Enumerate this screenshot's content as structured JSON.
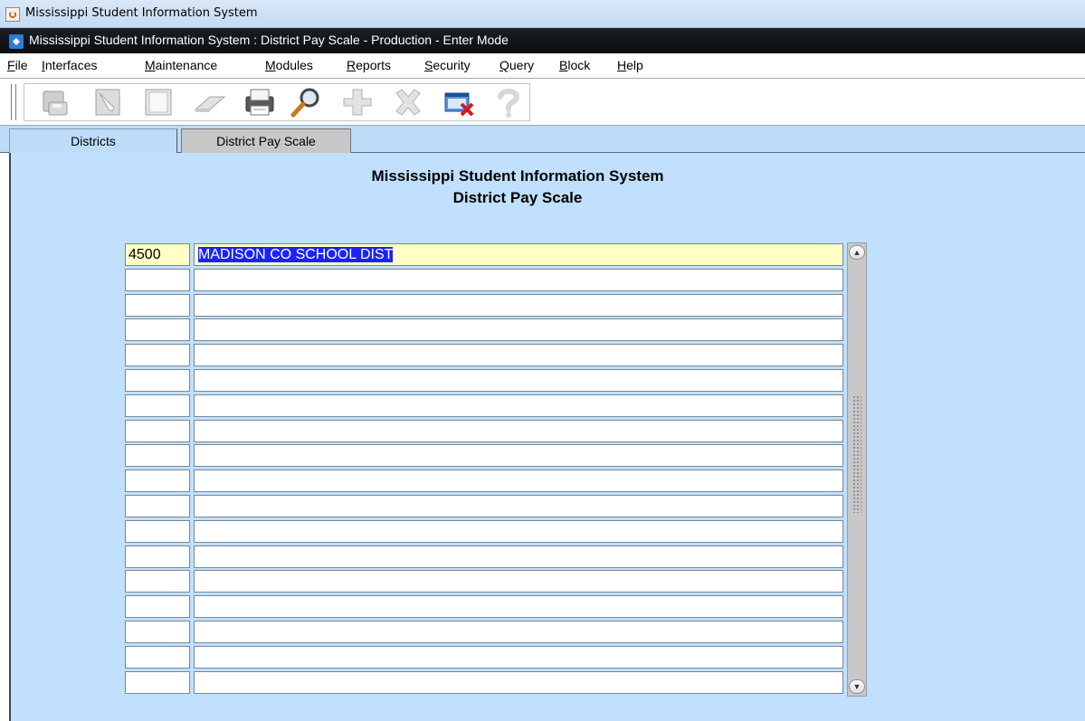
{
  "os_window": {
    "title": "Mississippi Student Information System"
  },
  "form_window": {
    "title": "Mississippi Student Information System : District Pay Scale  -  Production  -  Enter Mode"
  },
  "menu": [
    {
      "first": "F",
      "rest": "ile"
    },
    {
      "first": "I",
      "rest": "nterfaces"
    },
    {
      "first": "M",
      "rest": "aintenance"
    },
    {
      "first": "M",
      "rest": "odules"
    },
    {
      "first": "R",
      "rest": "eports"
    },
    {
      "first": "S",
      "rest": "ecurity"
    },
    {
      "first": "Q",
      "rest": "uery"
    },
    {
      "first": "B",
      "rest": "lock"
    },
    {
      "first": "H",
      "rest": "elp"
    }
  ],
  "toolbar": [
    "save-icon",
    "edit-icon",
    "document-icon",
    "eraser-icon",
    "print-icon",
    "search-icon",
    "add-icon",
    "delete-icon",
    "exit-icon",
    "help-icon"
  ],
  "tabs": [
    {
      "label": "Districts",
      "active": true
    },
    {
      "label": "District Pay Scale",
      "active": false
    }
  ],
  "page": {
    "title_line1": "Mississippi Student Information System",
    "title_line2": "District Pay Scale"
  },
  "records": [
    {
      "code": "4500",
      "name": "MADISON CO SCHOOL DIST"
    },
    {
      "code": "",
      "name": ""
    },
    {
      "code": "",
      "name": ""
    },
    {
      "code": "",
      "name": ""
    },
    {
      "code": "",
      "name": ""
    },
    {
      "code": "",
      "name": ""
    },
    {
      "code": "",
      "name": ""
    },
    {
      "code": "",
      "name": ""
    },
    {
      "code": "",
      "name": ""
    },
    {
      "code": "",
      "name": ""
    },
    {
      "code": "",
      "name": ""
    },
    {
      "code": "",
      "name": ""
    },
    {
      "code": "",
      "name": ""
    },
    {
      "code": "",
      "name": ""
    },
    {
      "code": "",
      "name": ""
    },
    {
      "code": "",
      "name": ""
    },
    {
      "code": "",
      "name": ""
    },
    {
      "code": "",
      "name": ""
    }
  ],
  "colors": {
    "panel": "#c0e0fd",
    "selection": "#1a23ff",
    "current_row": "#ffffc6"
  }
}
